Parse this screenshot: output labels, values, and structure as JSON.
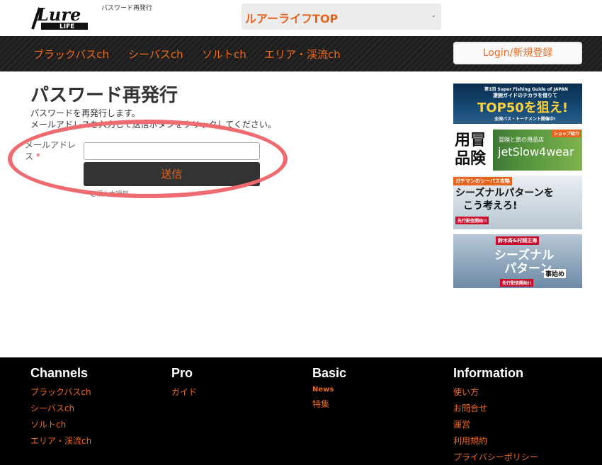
{
  "header": {
    "logo_top": "Lure",
    "logo_bottom": "LIFE",
    "subtitle": "パスワード再発行",
    "site_select": "ルアーライフTOP"
  },
  "nav": {
    "items": [
      "ブラックバスch",
      "シーバスch",
      "ソルトch",
      "エリア・渓流ch"
    ],
    "login": "Login/新規登録"
  },
  "main": {
    "title": "パスワード再発行",
    "desc1": "パスワードを再発行します。",
    "desc2": "メールアドレスを入力して送信ボタンをクリックしてください。",
    "field_label": "メールアドレス",
    "required_mark": "*",
    "email_value": "",
    "submit": "送信",
    "required_note": "* 必須入力項目"
  },
  "banners": {
    "b1_line1": "第1回 Super Fishing Guide of JAPAN",
    "b1_line2": "凄腕ガイドのチカラを借りて",
    "b1_main": "TOP50を狙え!",
    "b1_line3": "全国バス・トーナメント開催中!",
    "b2_kanji": "用冒品険",
    "b2_sub": "冒険と旅の用品店",
    "b2_main": "jetSlow4wear",
    "b2_tag": "ショップ紹介",
    "b3_tag": "ガチマンのシーバス攻略",
    "b3_main1": "シーズナルパターンを",
    "b3_main2": "こう考えろ!",
    "b3_note": "先行配信開始!!",
    "b4_tag": "鈴木斉&村越正海",
    "b4_main1": "シーズナル",
    "b4_main2": "パターン",
    "b4_sub": "事始め",
    "b4_note": "先行配信開始!!"
  },
  "footer": {
    "channels_title": "Channels",
    "channels": [
      "ブラックバスch",
      "シーバスch",
      "ソルトch",
      "エリア・渓流ch"
    ],
    "pro_title": "Pro",
    "pro": [
      "ガイド"
    ],
    "basic_title": "Basic",
    "basic_news": "News",
    "basic": [
      "特集"
    ],
    "info_title": "Information",
    "info": [
      "使い方",
      "お問合せ",
      "運営",
      "利用規約",
      "プライバシーポリシー"
    ]
  },
  "colors": {
    "accent": "#ee6a1e",
    "navbar": "#1e1e1e",
    "footer": "#000000",
    "oval": "#ee6b70"
  }
}
